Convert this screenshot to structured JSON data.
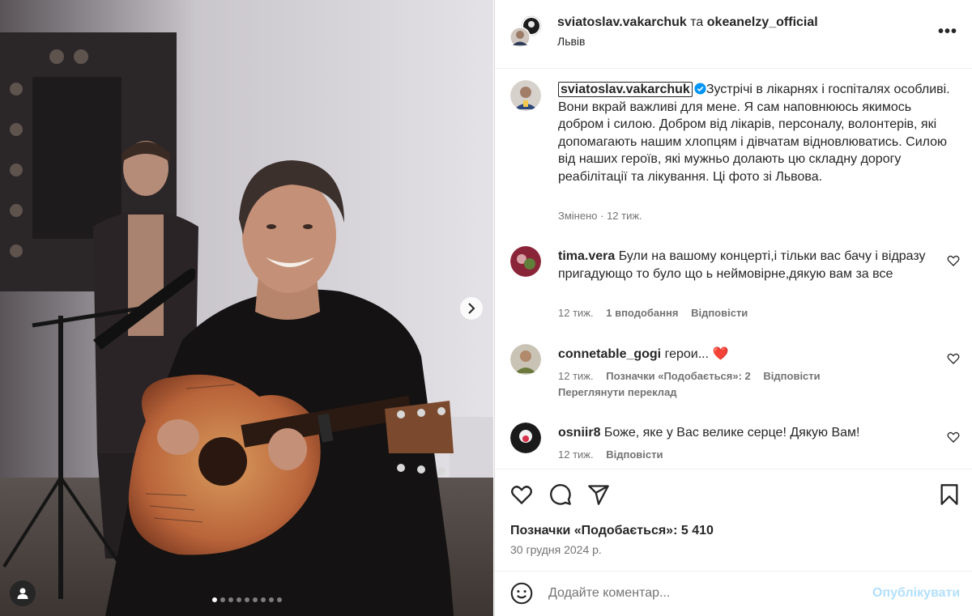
{
  "photo": {
    "carousel_dots": 9,
    "active_dot": 0,
    "tag_icon": "user-tag-icon",
    "next_icon": "chevron-right-icon"
  },
  "header": {
    "author": "sviatoslav.vakarchuk",
    "conjunction": "та",
    "coauthor": "okeanelzy_official",
    "location": "Львів",
    "more_icon": "more-horizontal-icon",
    "more_label": "•••"
  },
  "caption": {
    "username": "sviatoslav.vakarchuk",
    "verified_icon": "verified-badge-icon",
    "text": "Зустрічі в лікарнях і госпіталях особливі. Вони вкрай важливі для мене. Я сам наповнююсь якимось добром і силою. Добром від лікарів, персоналу, волонтерів, які допомагають нашим хлопцям і дівчатам відновлюватись. Силою від наших героїв, які мужньо долають цю складну дорогу реабілітації та лікування. Ці фото зі Львова.",
    "edited": "Змінено",
    "time": "12 тиж."
  },
  "comments": [
    {
      "username": "tima.vera",
      "text": "Були на вашому концерті,і тільки вас бачу і відразу пригадующо то було що ь неймовірне,дякую вам за все",
      "time": "12 тиж.",
      "likes": "1 вподобання",
      "reply": "Відповісти"
    },
    {
      "username": "connetable_gogi",
      "text": "герои... ",
      "emoji": "❤️",
      "time": "12 тиж.",
      "likes": "Позначки «Подобається»: 2",
      "reply": "Відповісти",
      "translate": "Переглянути переклад"
    },
    {
      "username": "osniir8",
      "text": "Боже, яке у Вас велике серце! Дякую Вам!",
      "time": "12 тиж.",
      "reply": "Відповісти"
    }
  ],
  "actions": {
    "like_icon": "heart-icon",
    "comment_icon": "comment-icon",
    "share_icon": "send-icon",
    "save_icon": "bookmark-icon",
    "likes_label": "Позначки «Подобається»: 5 410",
    "date": "30 грудня 2024 р."
  },
  "composer": {
    "emoji_icon": "emoji-smile-icon",
    "placeholder": "Додайте коментар...",
    "post_label": "Опублікувати",
    "post_color": "#b2dffc"
  },
  "colors": {
    "text": "#262626",
    "muted": "#737373",
    "border": "#dbdbdb",
    "like_heart": "#ed4956",
    "verified": "#0095f6"
  }
}
